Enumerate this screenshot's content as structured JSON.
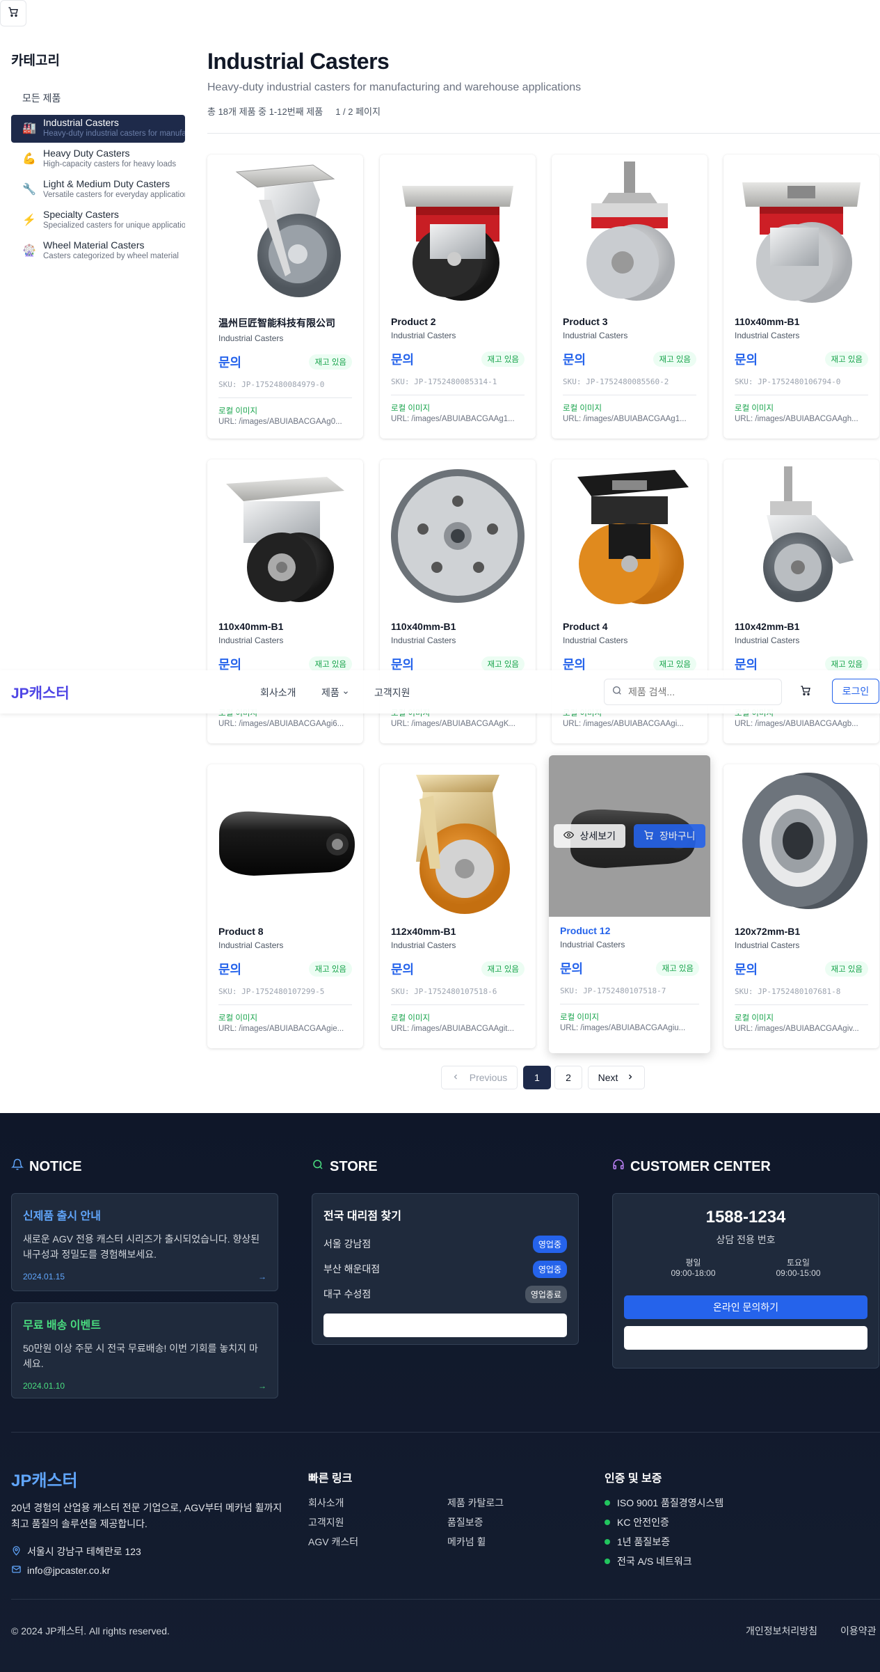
{
  "sidebar": {
    "title": "카테고리",
    "all_label": "모든 제품",
    "items": [
      {
        "label": "Industrial Casters",
        "desc": "Heavy-duty industrial casters for manufacturing",
        "icon": "factory-icon",
        "glyph": "🏭"
      },
      {
        "label": "Heavy Duty Casters",
        "desc": "High-capacity casters for heavy loads",
        "icon": "muscle-icon",
        "glyph": "💪"
      },
      {
        "label": "Light & Medium Duty Casters",
        "desc": "Versatile casters for everyday applications",
        "icon": "wrench-icon",
        "glyph": "🔧"
      },
      {
        "label": "Specialty Casters",
        "desc": "Specialized casters for unique applications",
        "icon": "lightning-icon",
        "glyph": "⚡"
      },
      {
        "label": "Wheel Material Casters",
        "desc": "Casters categorized by wheel material",
        "icon": "ferris-wheel-icon",
        "glyph": "🎡"
      }
    ]
  },
  "main": {
    "title": "Industrial Casters",
    "subtitle": "Heavy-duty industrial casters for manufacturing and warehouse applications",
    "count_text": "총 18개 제품 중 1-12번째 제품",
    "page_text": "1 / 2 페이지"
  },
  "products": [
    {
      "name": "温州巨匠智能科技有限公司",
      "category": "Industrial Casters",
      "price": "문의",
      "stock": "재고 있음",
      "sku": "SKU: JP-1752480084979-0",
      "image_label": "로컬 이미지",
      "url": "URL: /images/ABUIABACGAAg0..."
    },
    {
      "name": "Product 2",
      "category": "Industrial Casters",
      "price": "문의",
      "stock": "재고 있음",
      "sku": "SKU: JP-1752480085314-1",
      "image_label": "로컬 이미지",
      "url": "URL: /images/ABUIABACGAAg1..."
    },
    {
      "name": "Product 3",
      "category": "Industrial Casters",
      "price": "문의",
      "stock": "재고 있음",
      "sku": "SKU: JP-1752480085560-2",
      "image_label": "로컬 이미지",
      "url": "URL: /images/ABUIABACGAAg1..."
    },
    {
      "name": "110x40mm-B1",
      "category": "Industrial Casters",
      "price": "문의",
      "stock": "재고 있음",
      "sku": "SKU: JP-1752480106794-0",
      "image_label": "로컬 이미지",
      "url": "URL: /images/ABUIABACGAAgh..."
    },
    {
      "name": "110x40mm-B1",
      "category": "Industrial Casters",
      "price": "문의",
      "stock": "재고 있음",
      "sku": "",
      "image_label": "로컬 이미지",
      "url": "URL: /images/ABUIABACGAAgi6..."
    },
    {
      "name": "110x40mm-B1",
      "category": "Industrial Casters",
      "price": "문의",
      "stock": "재고 있음",
      "sku": "",
      "image_label": "로컬 이미지",
      "url": "URL: /images/ABUIABACGAAgK..."
    },
    {
      "name": "Product 4",
      "category": "Industrial Casters",
      "price": "문의",
      "stock": "재고 있음",
      "sku": "",
      "image_label": "로컬 이미지",
      "url": "URL: /images/ABUIABACGAAgi..."
    },
    {
      "name": "110x42mm-B1",
      "category": "Industrial Casters",
      "price": "문의",
      "stock": "재고 있음",
      "sku": "",
      "image_label": "로컬 이미지",
      "url": "URL: /images/ABUIABACGAAgb..."
    },
    {
      "name": "Product 8",
      "category": "Industrial Casters",
      "price": "문의",
      "stock": "재고 있음",
      "sku": "SKU: JP-1752480107299-5",
      "image_label": "로컬 이미지",
      "url": "URL: /images/ABUIABACGAAgie..."
    },
    {
      "name": "112x40mm-B1",
      "category": "Industrial Casters",
      "price": "문의",
      "stock": "재고 있음",
      "sku": "SKU: JP-1752480107518-6",
      "image_label": "로컬 이미지",
      "url": "URL: /images/ABUIABACGAAgit..."
    },
    {
      "name": "Product 12",
      "category": "Industrial Casters",
      "price": "문의",
      "stock": "재고 있음",
      "sku": "SKU: JP-1752480107518-7",
      "image_label": "로컬 이미지",
      "url": "URL: /images/ABUIABACGAAgiu..."
    },
    {
      "name": "120x72mm-B1",
      "category": "Industrial Casters",
      "price": "문의",
      "stock": "재고 있음",
      "sku": "SKU: JP-1752480107681-8",
      "image_label": "로컬 이미지",
      "url": "URL: /images/ABUIABACGAAgiv..."
    }
  ],
  "hover_overlay": {
    "detail_label": "상세보기",
    "cart_label": "장바구니"
  },
  "nav": {
    "logo": "JP캐스터",
    "links": [
      "회사소개",
      "제품",
      "고객지원"
    ],
    "search_placeholder": "제품 검색...",
    "login_label": "로그인"
  },
  "pagination": {
    "prev": "Previous",
    "pages": [
      "1",
      "2"
    ],
    "current": "1",
    "next": "Next"
  },
  "footer": {
    "notice": {
      "title": "NOTICE",
      "items": [
        {
          "title": "신제품 출시 안내",
          "body": "새로운 AGV 전용 캐스터 시리즈가 출시되었습니다. 향상된 내구성과 정밀도를 경험해보세요.",
          "date": "2024.01.15",
          "color": "#60a5fa"
        },
        {
          "title": "무료 배송 이벤트",
          "body": "50만원 이상 주문 시 전국 무료배송! 이번 기회를 놓치지 마세요.",
          "date": "2024.01.10",
          "color": "#4ade80"
        }
      ]
    },
    "store": {
      "title": "STORE",
      "box_title": "전국 대리점 찾기",
      "items": [
        {
          "name": "서울 강남점",
          "status": "영업중",
          "color": "#2563eb"
        },
        {
          "name": "부산 해운대점",
          "status": "영업중",
          "color": "#2563eb"
        },
        {
          "name": "대구 수성점",
          "status": "영업종료",
          "color": "#4b5563"
        }
      ]
    },
    "customer": {
      "title": "CUSTOMER CENTER",
      "phone": "1588-1234",
      "phone_label": "상담 전용 번호",
      "weekday_label": "평일",
      "weekday_hours": "09:00-18:00",
      "saturday_label": "토요일",
      "saturday_hours": "09:00-15:00",
      "inquiry_label": "온라인 문의하기"
    },
    "brand": {
      "logo": "JP캐스터",
      "desc": "20년 경험의 산업용 캐스터 전문 기업으로, AGV부터 메카넘 휠까지 최고 품질의 솔루션을 제공합니다.",
      "address": "서울시 강남구 테헤란로 123",
      "email": "info@jpcaster.co.kr"
    },
    "quick_links": {
      "title": "빠른 링크",
      "items": [
        "회사소개",
        "제품 카탈로그",
        "고객지원",
        "품질보증",
        "AGV 캐스터",
        "메카넘 휠"
      ]
    },
    "certs": {
      "title": "인증 및 보증",
      "items": [
        "ISO 9001 품질경영시스템",
        "KC 안전인증",
        "1년 품질보증",
        "전국 A/S 네트워크"
      ]
    },
    "copyright": "© 2024 JP캐스터. All rights reserved.",
    "legal": [
      "개인정보처리방침",
      "이용약관"
    ]
  }
}
